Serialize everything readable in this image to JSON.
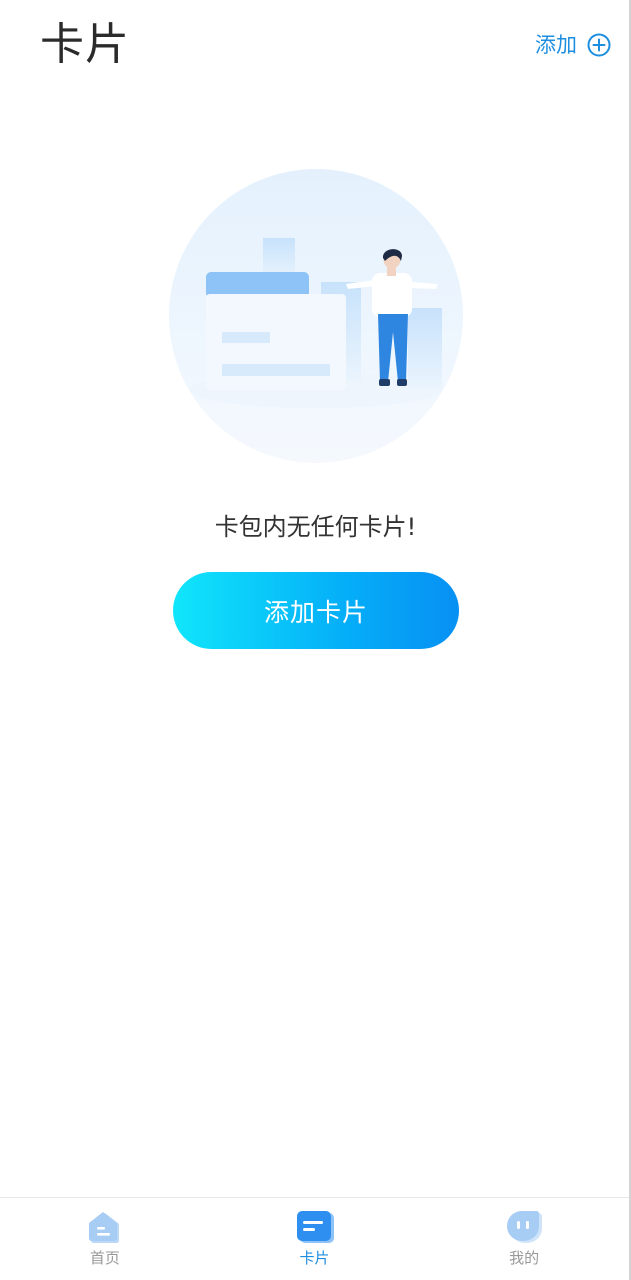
{
  "header": {
    "title": "卡片",
    "add_label": "添加",
    "add_icon": "plus-circle-icon"
  },
  "empty_state": {
    "illustration": "empty-card-wallet-illustration",
    "message": "卡包内无任何卡片!",
    "button_label": "添加卡片"
  },
  "tabbar": {
    "tabs": [
      {
        "label": "首页",
        "icon": "home-icon",
        "active": false
      },
      {
        "label": "卡片",
        "icon": "card-icon",
        "active": true
      },
      {
        "label": "我的",
        "icon": "profile-icon",
        "active": false
      }
    ]
  },
  "colors": {
    "accent": "#1e8ee0",
    "button_gradient_start": "#10e6fb",
    "button_gradient_end": "#0790f3",
    "inactive_tab": "#999999",
    "title_text": "#2b2b2b"
  }
}
